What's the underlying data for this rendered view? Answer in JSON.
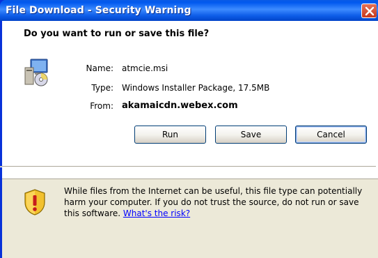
{
  "window": {
    "title": "File Download - Security Warning"
  },
  "dialog": {
    "question": "Do you want to run or save this file?",
    "fields": [
      {
        "label": "Name:",
        "value": "atmcie.msi"
      },
      {
        "label": "Type:",
        "value": "Windows Installer Package, 17.5MB"
      },
      {
        "label": "From:",
        "value": "akamaicdn.webex.com"
      }
    ],
    "buttons": {
      "run": "Run",
      "save": "Save",
      "cancel": "Cancel"
    },
    "warning": {
      "text": "While files from the Internet can be useful, this file type can potentially harm your computer. If you do not trust the source, do not run or save this software.",
      "link": "What's the risk?"
    }
  },
  "icons": {
    "title_close": "close-icon",
    "file": "installer-package-icon",
    "warning": "shield-warning-icon"
  }
}
